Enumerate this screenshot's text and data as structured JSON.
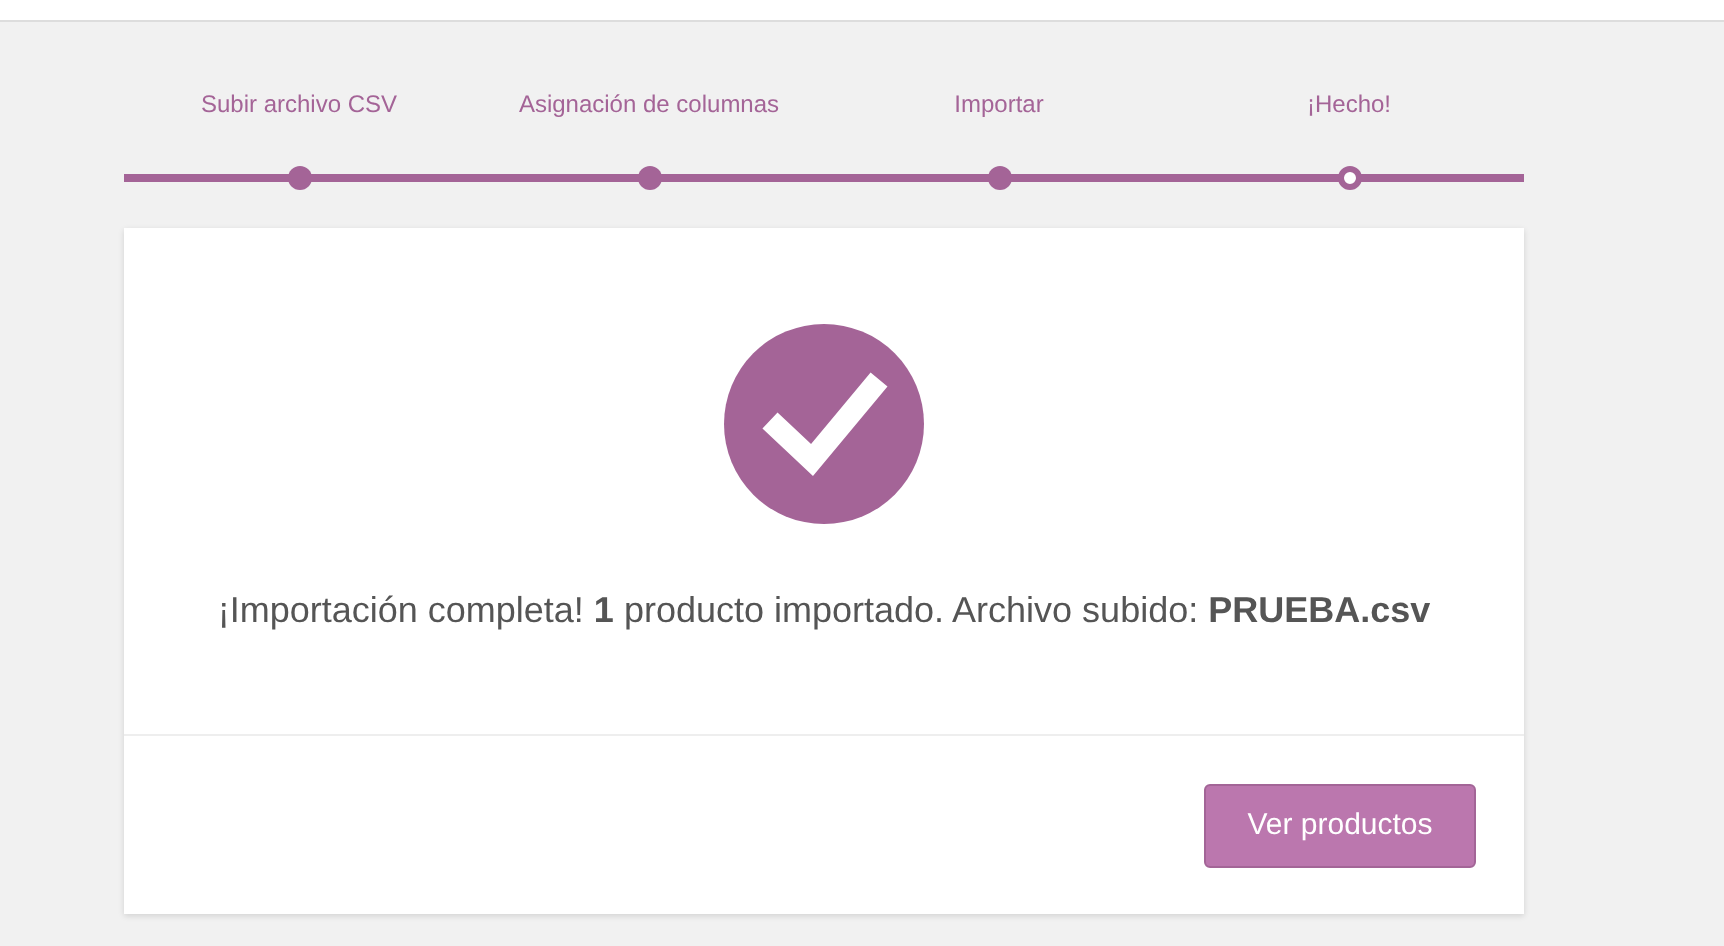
{
  "steps": [
    {
      "label": "Subir archivo CSV",
      "selected": false
    },
    {
      "label": "Asignación de columnas",
      "selected": false
    },
    {
      "label": "Importar",
      "selected": false
    },
    {
      "label": "¡Hecho!",
      "selected": true
    }
  ],
  "message": "¡Importación completa! **1** producto importado. Archivo subido: **PRUEBA.csv**",
  "button": "Ver productos"
}
